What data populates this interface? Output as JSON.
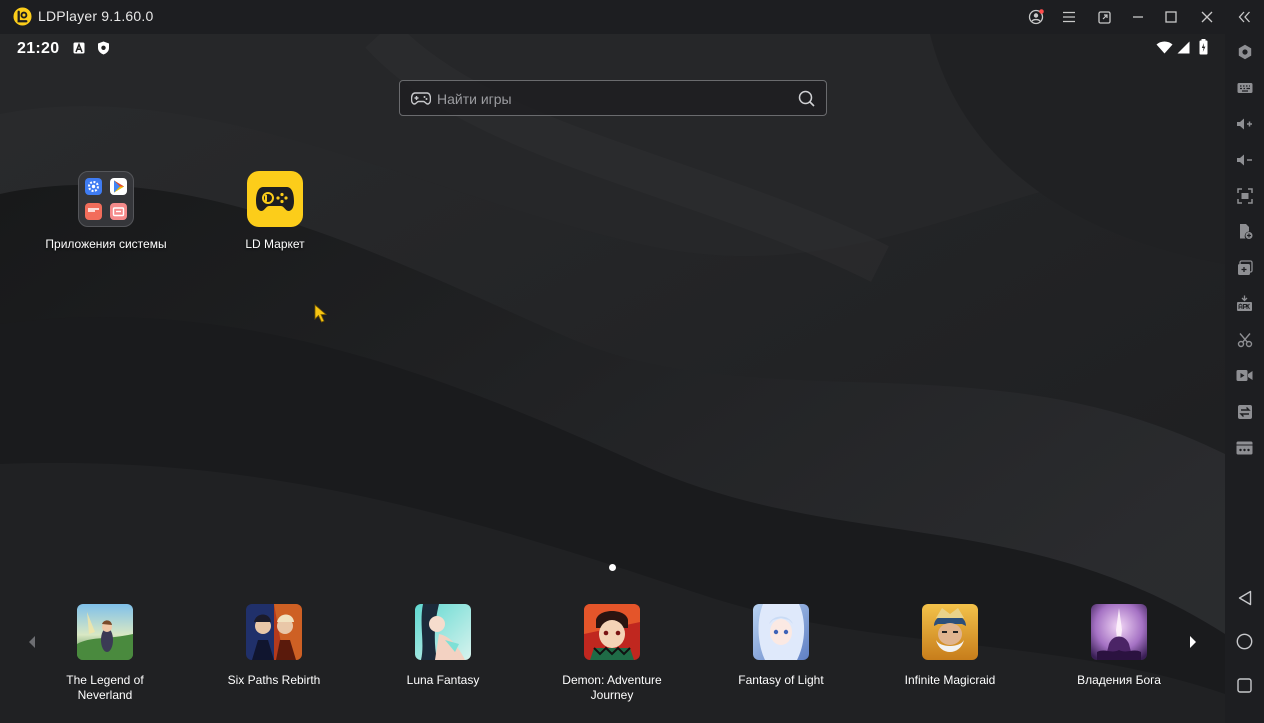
{
  "window": {
    "title": "LDPlayer 9.1.60.0"
  },
  "titlebar_buttons": [
    "account-icon",
    "menu-icon",
    "restore-window-icon",
    "minimize-icon",
    "maximize-icon",
    "close-icon",
    "collapse-sidebar-icon"
  ],
  "statusbar": {
    "time": "21:20",
    "left_icons": [
      "text-a-icon",
      "shield-icon"
    ],
    "right_icons": [
      "wifi-icon",
      "signal-icon",
      "battery-icon"
    ]
  },
  "search": {
    "placeholder": "Найти игры"
  },
  "desktop": {
    "apps": [
      {
        "label": "Приложения системы",
        "icon": "system-apps-folder-icon"
      },
      {
        "label": "LD Маркет",
        "icon": "ld-market-icon"
      }
    ]
  },
  "dock": {
    "items": [
      {
        "label": "The Legend of Neverland",
        "icon": "legend-of-neverland-icon"
      },
      {
        "label": "Six Paths Rebirth",
        "icon": "six-paths-rebirth-icon"
      },
      {
        "label": "Luna Fantasy",
        "icon": "luna-fantasy-icon"
      },
      {
        "label": "Demon: Adventure Journey",
        "icon": "demon-adventure-journey-icon"
      },
      {
        "label": "Fantasy of Light",
        "icon": "fantasy-of-light-icon"
      },
      {
        "label": "Infinite Magicraid",
        "icon": "infinite-magicraid-icon"
      },
      {
        "label": "Владения Бога",
        "icon": "vladeniya-boga-icon"
      }
    ]
  },
  "sidebar": {
    "tools": [
      "settings-icon",
      "keyboard-mapping-icon",
      "volume-up-icon",
      "volume-down-icon",
      "screenshot-icon",
      "install-apk-icon",
      "multi-instance-icon",
      "apk-icon",
      "operation-record-icon",
      "record-video-icon",
      "sync-icon",
      "more-icon"
    ],
    "nav": [
      "back-icon",
      "home-icon",
      "recents-icon"
    ]
  },
  "colors": {
    "titlebar_bg": "#1d1e21",
    "brand_yellow": "#fccd1a",
    "wallpaper_base": "#222325"
  }
}
